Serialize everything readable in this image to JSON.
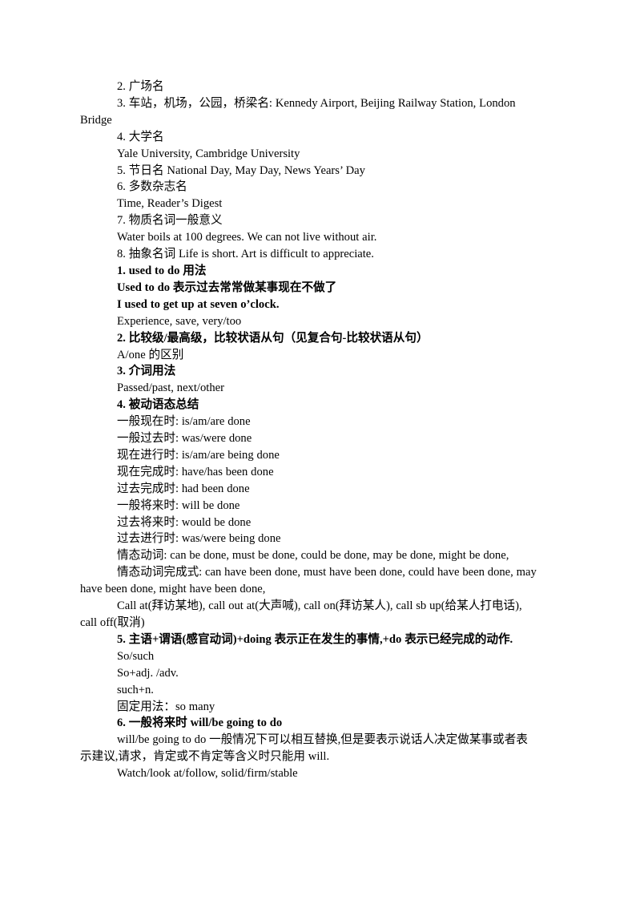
{
  "document": {
    "page_background": "#ffffff",
    "text_color": "#000000",
    "blocks": [
      {
        "id": "b01",
        "style": "plain",
        "text": "2. 广场名"
      },
      {
        "id": "b02",
        "style": "plain",
        "text": "3. 车站，机场，公园，桥梁名: Kennedy Airport, Beijing Railway Station, London Bridge"
      },
      {
        "id": "b03",
        "style": "plain",
        "text": "4. 大学名"
      },
      {
        "id": "b04",
        "style": "plain",
        "text": "Yale University, Cambridge University"
      },
      {
        "id": "b05",
        "style": "plain",
        "text": "5. 节日名 National Day, May Day, News Years’ Day"
      },
      {
        "id": "b06",
        "style": "plain",
        "text": "6. 多数杂志名"
      },
      {
        "id": "b07",
        "style": "plain",
        "text": "Time, Reader’s Digest"
      },
      {
        "id": "b08",
        "style": "plain",
        "text": "7. 物质名词一般意义"
      },
      {
        "id": "b09",
        "style": "plain",
        "text": "Water boils at 100 degrees. We can not live without air."
      },
      {
        "id": "b10",
        "style": "plain",
        "text": "8. 抽象名词 Life is short. Art is difficult to appreciate."
      },
      {
        "id": "b11",
        "style": "heading",
        "text": "1. used to do  用法"
      },
      {
        "id": "b12",
        "style": "heading",
        "text": "Used to do  表示过去常常做某事现在不做了"
      },
      {
        "id": "b13",
        "style": "heading",
        "text": "I used to get up at seven o’clock."
      },
      {
        "id": "b14",
        "style": "plain",
        "text": "Experience, save, very/too"
      },
      {
        "id": "b15",
        "style": "heading",
        "text": "2. 比较级/最高级，比较状语从句（见复合句-比较状语从句）"
      },
      {
        "id": "b16",
        "style": "plain",
        "text": "A/one 的区别"
      },
      {
        "id": "b17",
        "style": "heading",
        "text": "3. 介词用法"
      },
      {
        "id": "b18",
        "style": "plain",
        "text": "Passed/past, next/other"
      },
      {
        "id": "b19",
        "style": "heading",
        "text": "4. 被动语态总结"
      },
      {
        "id": "b20",
        "style": "plain",
        "text": "一般现在时: is/am/are  done"
      },
      {
        "id": "b21",
        "style": "plain",
        "text": "一般过去时: was/were done"
      },
      {
        "id": "b22",
        "style": "plain",
        "text": "现在进行时: is/am/are  being done"
      },
      {
        "id": "b23",
        "style": "plain",
        "text": "现在完成时: have/has been done"
      },
      {
        "id": "b24",
        "style": "plain",
        "text": "过去完成时: had been done"
      },
      {
        "id": "b25",
        "style": "plain",
        "text": "一般将来时: will be done"
      },
      {
        "id": "b26",
        "style": "plain",
        "text": "过去将来时: would be done"
      },
      {
        "id": "b27",
        "style": "plain",
        "text": "过去进行时: was/were being done"
      },
      {
        "id": "b28",
        "style": "plain",
        "text": "情态动词: can be done, must be done, could be done, may be done, might be done,"
      },
      {
        "id": "b29",
        "style": "plain",
        "text": "情态动词完成式: can have been done, must have been done, could have been done, may have been done, might have been done,"
      },
      {
        "id": "b30",
        "style": "plain",
        "text": "Call at(拜访某地), call out at(大声喊), call on(拜访某人), call sb up(给某人打电话), call off(取消)"
      },
      {
        "id": "b31",
        "style": "heading",
        "text": "5. 主语+谓语(感官动词)+doing 表示正在发生的事情,+do 表示已经完成的动作."
      },
      {
        "id": "b32",
        "style": "plain",
        "text": "So/such"
      },
      {
        "id": "b33",
        "style": "plain",
        "text": "So+adj. /adv."
      },
      {
        "id": "b34",
        "style": "plain",
        "text": "such+n."
      },
      {
        "id": "b35",
        "style": "plain",
        "text": "固定用法：so many"
      },
      {
        "id": "b36",
        "style": "heading",
        "text": "6. 一般将来时 will/be going to do"
      },
      {
        "id": "b37",
        "style": "plain",
        "text": "will/be going to do 一般情况下可以相互替换,但是要表示说话人决定做某事或者表示建议,请求，肯定或不肯定等含义时只能用 will."
      },
      {
        "id": "b38",
        "style": "plain",
        "text": "Watch/look at/follow, solid/firm/stable"
      }
    ]
  }
}
